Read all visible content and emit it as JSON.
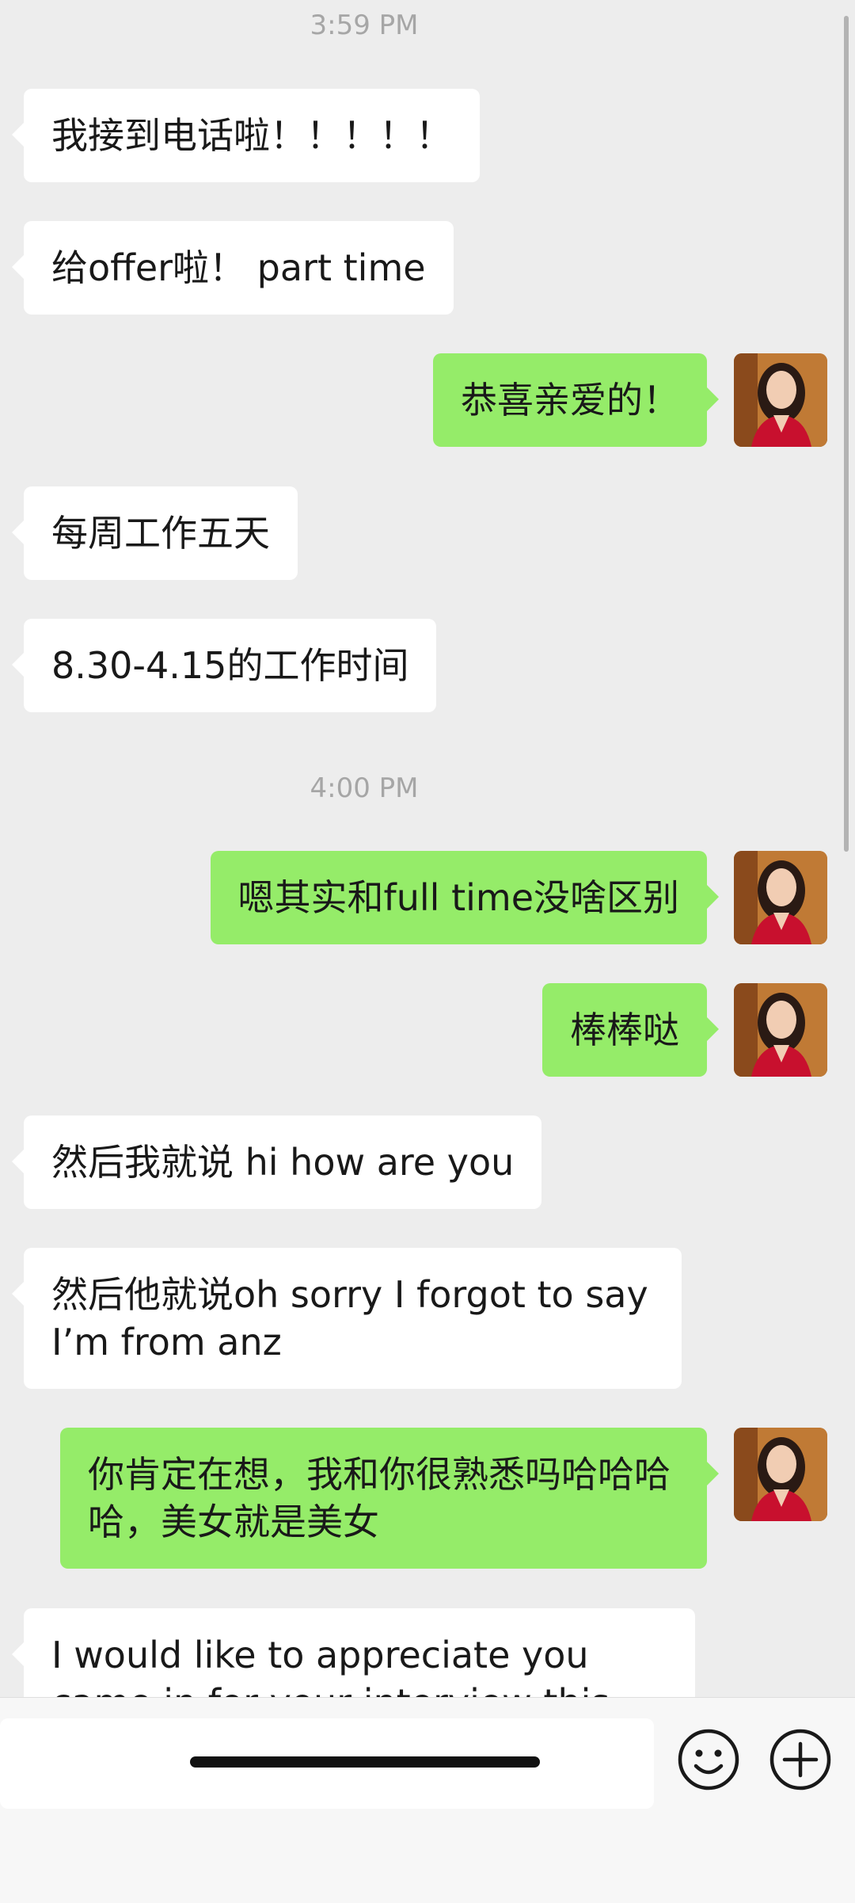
{
  "chat": {
    "timestamps": [
      "3:59 PM",
      "4:00 PM"
    ],
    "messages": [
      {
        "from": "contact",
        "text": "我接到电话啦！！！！！"
      },
      {
        "from": "contact",
        "text": "给offer啦！ part time"
      },
      {
        "from": "me",
        "text": "恭喜亲爱的！"
      },
      {
        "from": "contact",
        "text": "每周工作五天"
      },
      {
        "from": "contact",
        "text": "8.30-4.15的工作时间"
      },
      {
        "from": "me",
        "text": "嗯其实和full time没啥区别"
      },
      {
        "from": "me",
        "text": "棒棒哒"
      },
      {
        "from": "contact",
        "text": "然后我就说 hi how are you"
      },
      {
        "from": "contact",
        "text": "然后他就说oh sorry I forgot to say I’m from anz"
      },
      {
        "from": "me",
        "text": "你肯定在想，我和你很熟悉吗哈哈哈哈，美女就是美女"
      },
      {
        "from": "contact",
        "text": "I would like to appreciate you came in for your interview this morning"
      }
    ]
  },
  "input": {
    "value": "",
    "emoji_icon": "emoji-icon",
    "more_icon": "plus-circle-icon"
  },
  "colors": {
    "background": "#ededed",
    "incoming_bubble": "#ffffff",
    "outgoing_bubble": "#95ec69",
    "timestamp_text": "#a6a6a6"
  }
}
